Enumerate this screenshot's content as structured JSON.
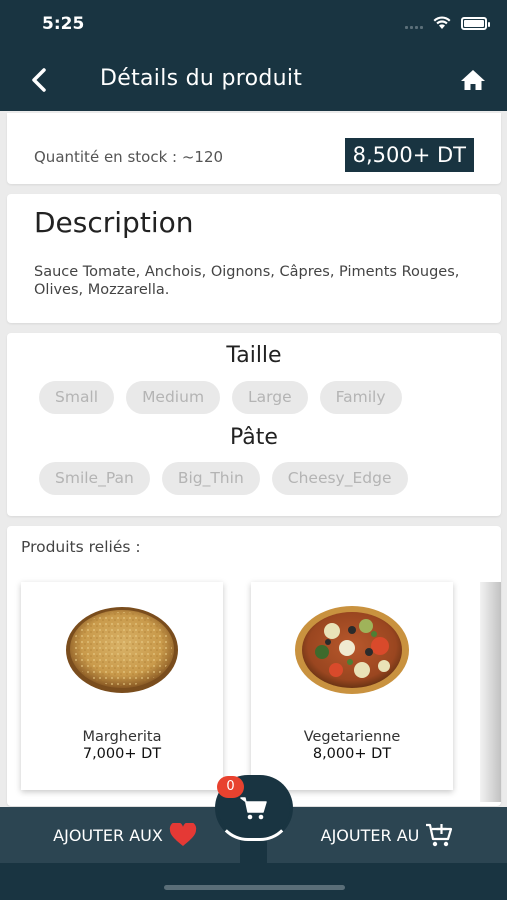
{
  "status": {
    "time": "5:25"
  },
  "header": {
    "title": "Détails du produit",
    "back_icon": "chevron-left-icon",
    "home_icon": "home-icon"
  },
  "stock": {
    "label": "Quantité en stock : ~120",
    "price": "8,500+ DT"
  },
  "description": {
    "title": "Description",
    "text": "Sauce Tomate, Anchois, Oignons, Câpres, Piments Rouges, Olives, Mozzarella."
  },
  "options": {
    "size_heading": "Taille",
    "sizes": [
      "Small",
      "Medium",
      "Large",
      "Family"
    ],
    "crust_heading": "Pâte",
    "crusts": [
      "Smile_Pan",
      "Big_Thin",
      "Cheesy_Edge"
    ]
  },
  "related": {
    "label": "Produits reliés :",
    "products": [
      {
        "name": "Margherita",
        "price": "7,000+ DT"
      },
      {
        "name": "Vegetarienne",
        "price": "8,000+ DT"
      }
    ]
  },
  "bottom": {
    "favorites_label": "AJOUTER AUX",
    "cart_label": "AJOUTER AU",
    "cart_count": "0"
  },
  "colors": {
    "primary": "#193441",
    "button": "#2c4552",
    "badge": "#e8422f",
    "heart": "#e53935"
  }
}
